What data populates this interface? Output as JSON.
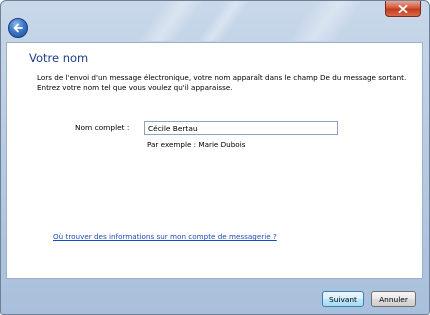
{
  "window": {
    "close_icon": "close-icon",
    "back_icon": "back-arrow-icon"
  },
  "page": {
    "title": "Votre nom",
    "intro_line1": "Lors de l'envoi d'un message électronique, votre nom apparaît dans le champ De du message sortant.",
    "intro_line2": "Entrez votre nom tel que vous voulez qu'il apparaisse."
  },
  "form": {
    "full_name_label": "Nom complet :",
    "full_name_value": "Cécile Bertau",
    "example_text": "Par exemple : Marie Dubois"
  },
  "help": {
    "link_text": "Où trouver des informations sur mon compte de messagerie ?"
  },
  "buttons": {
    "next_label": "Suivant",
    "cancel_label": "Annuler"
  },
  "colors": {
    "heading": "#1e3e8c",
    "link": "#1a4bbf",
    "close_button": "#c33a1c",
    "titlebar": "#b7cbe3"
  }
}
